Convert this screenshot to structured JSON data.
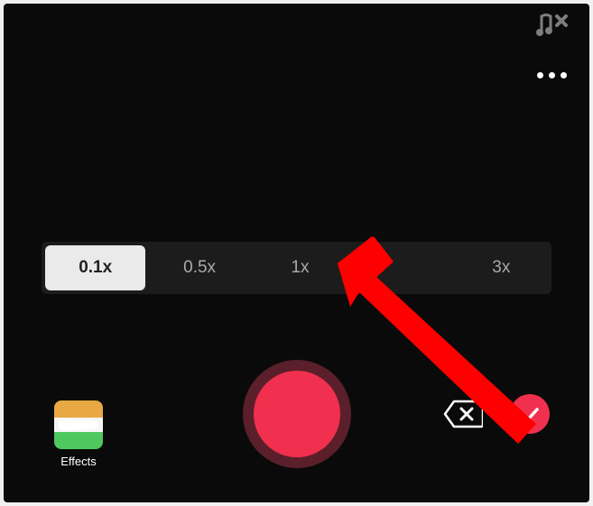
{
  "topbar": {
    "sound_edit_icon": "sound-edit",
    "more_icon": "more"
  },
  "speed": {
    "options": [
      "0.1x",
      "0.5x",
      "1x",
      "",
      "3x"
    ],
    "active_index": 0
  },
  "effects": {
    "label": "Effects"
  },
  "colors": {
    "accent": "#f0304e",
    "record_ring": "#5a1f2a",
    "annotation": "#ff0000"
  }
}
